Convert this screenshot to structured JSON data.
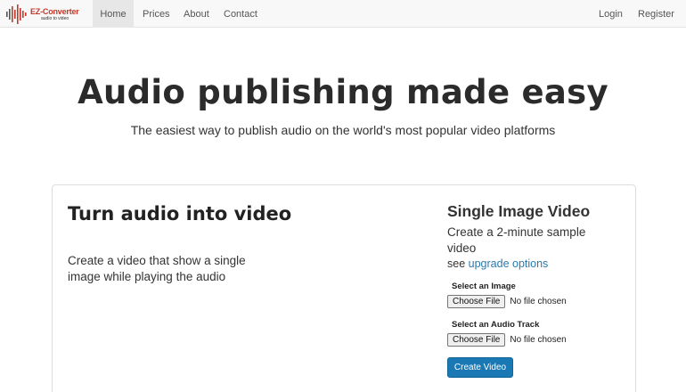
{
  "brand": {
    "name": "EZ-Converter",
    "sub": "audio to video",
    "accent": "#c0392b"
  },
  "nav": {
    "left": [
      {
        "label": "Home",
        "active": true
      },
      {
        "label": "Prices",
        "active": false
      },
      {
        "label": "About",
        "active": false
      },
      {
        "label": "Contact",
        "active": false
      }
    ],
    "right": [
      {
        "label": "Login"
      },
      {
        "label": "Register"
      }
    ]
  },
  "hero": {
    "title": "Audio publishing made easy",
    "subtitle": "The easiest way to publish audio on the world's most popular video platforms"
  },
  "panel": {
    "left": {
      "title": "Turn audio into video",
      "description": "Create a video that show a single image while playing the audio"
    },
    "right": {
      "title": "Single Image Video",
      "description": "Create a 2-minute sample video",
      "upgrade_prefix": "see",
      "upgrade_link": "upgrade options",
      "image_field": {
        "label": "Select an Image",
        "button": "Choose File",
        "status": "No file chosen"
      },
      "audio_field": {
        "label": "Select an Audio Track",
        "button": "Choose File",
        "status": "No file chosen"
      },
      "submit_label": "Create Video",
      "submit_color": "#1a78b5"
    }
  }
}
